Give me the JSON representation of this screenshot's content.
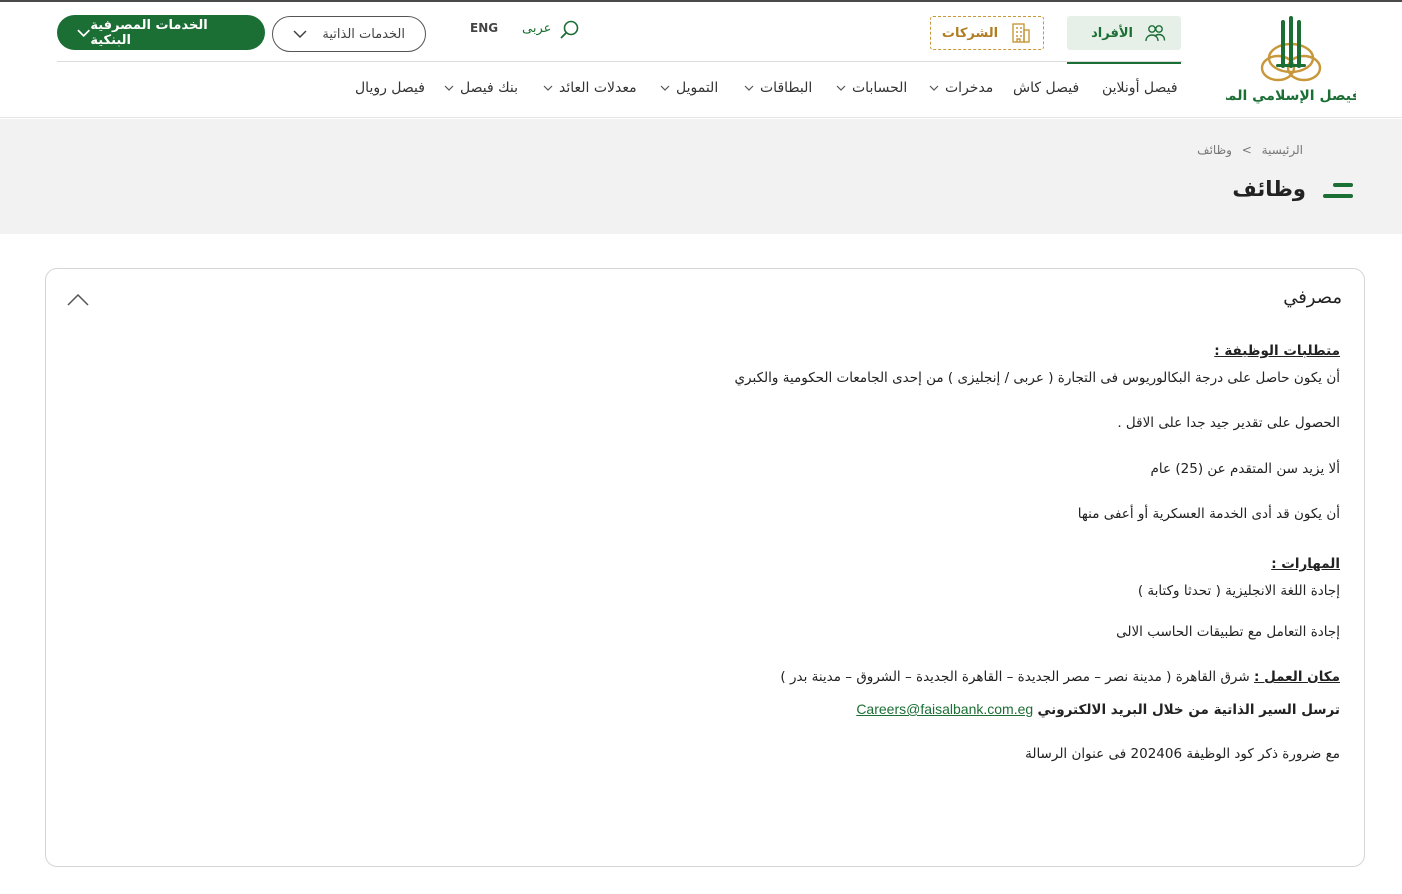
{
  "header": {
    "segments": {
      "individuals": "الأفراد",
      "companies": "الشركات"
    },
    "lang_arabic": "عربى",
    "lang_english": "ENG",
    "self_services": "الخدمات الذاتية",
    "banking_services": "الخدمات المصرفية البنكية",
    "logo_text": "بنك فيصل الإسلامي المصري"
  },
  "nav": {
    "items": [
      {
        "label": "فيصل أونلاين",
        "has_menu": false
      },
      {
        "label": "فيصل كاش",
        "has_menu": false
      },
      {
        "label": "مدخرات",
        "has_menu": true
      },
      {
        "label": "الحسابات",
        "has_menu": true
      },
      {
        "label": "البطاقات",
        "has_menu": true
      },
      {
        "label": "التمويل",
        "has_menu": true
      },
      {
        "label": "معدلات العائد",
        "has_menu": true
      },
      {
        "label": "بنك فيصل",
        "has_menu": true
      },
      {
        "label": "فيصل رويال",
        "has_menu": false
      }
    ]
  },
  "page": {
    "breadcrumb": {
      "home": "الرئيسية",
      "separator": ">",
      "current": "وظائف"
    },
    "title": "وظائف"
  },
  "job": {
    "title": "مصرفي",
    "requirements_heading": "متطلبات الوظيفة :",
    "requirements": [
      "أن يكون حاصل على درجة البكالوريوس فى التجارة ( عربى / إنجليزى ) من إحدى الجامعات الحكومية والكبري",
      "الحصول على تقدير جيد جدا على الاقل .",
      "ألا يزيد سن المتقدم عن (25) عام",
      "أن يكون قد أدى الخدمة العسكرية أو أعفى منها"
    ],
    "skills_heading": "المهارات :",
    "skills": [
      "إجادة اللغة الانجليزية ( تحدثا وكتابة )",
      "إجادة التعامل مع تطبيقات الحاسب الالى"
    ],
    "location_label": "مكان العمل :",
    "location_value": " شرق القاهرة ( مدينة نصر – مصر الجديدة – القاهرة الجديدة – الشروق – مدينة بدر )",
    "cv_instruction": "ترسل السير الذاتية من خلال البريد الالكتروني",
    "email": "Careers@faisalbank.com.eg",
    "code_note": "مع ضرورة ذكر كود الوظيفة 202406 فى عنوان الرسالة"
  },
  "colors": {
    "brand_green": "#1b6e34",
    "gold": "#c7973a",
    "band_gray": "#f2f2f2"
  }
}
